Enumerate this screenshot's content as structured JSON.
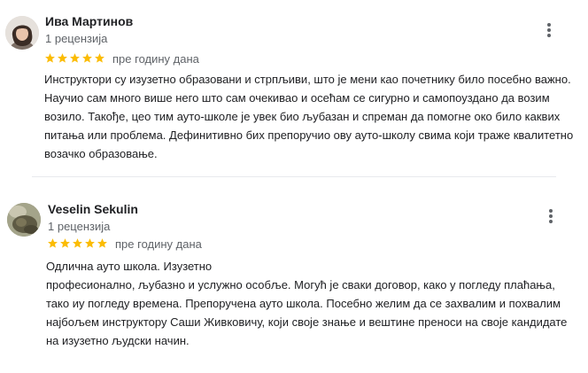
{
  "reviews": [
    {
      "author": "Ива Мартинов",
      "review_count": "1 рецензија",
      "rating": 5,
      "date": "пре годину дана",
      "text_lines": [
        "Инструктори су изузетно образовани и стрпљиви, што је мени као почетнику било посебно важно.",
        "Научио сам много више него што сам очекивао и осећам се сигурно и самопоуздано да возим",
        "возило. Такође, цео тим ауто-школе је увек био љубазан и спреман да помогне око било каквих",
        "питања или проблема. Дефинитивно бих препоручио ову ауто-школу свима који траже квалитетно",
        "возачко образовање."
      ]
    },
    {
      "author": "Veselin Sekulin",
      "review_count": "1 рецензија",
      "rating": 5,
      "date": "пре годину дана",
      "text_lines": [
        "Одлична ауто школа. Изузетно",
        "професионално, љубазно и услужно особље. Могућ је сваки договор, како у погледу плаћања,",
        "тако иу погледу времена. Препоручена ауто школа. Посебно желим да се захвалим и похвалим",
        "најбољем инструктору Саши Живковичу, који своје знање и вештине преноси на своје кандидате",
        "на изузетно људски начин."
      ]
    }
  ],
  "colors": {
    "star": "#fbbc04",
    "meta": "#5f6368",
    "text": "#202124"
  },
  "icons": {
    "menu": "more-vert-icon",
    "rating": "star-icon"
  }
}
